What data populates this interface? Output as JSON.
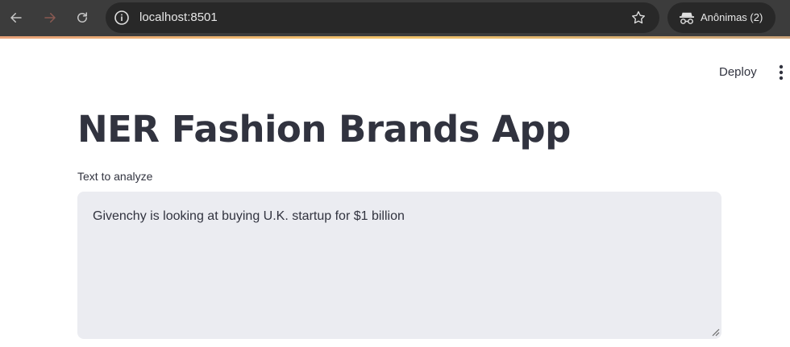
{
  "browser": {
    "url": "localhost:8501",
    "incognito_label": "Anônimas (2)",
    "icons": {
      "back": "arrow-left-icon",
      "forward": "arrow-right-icon",
      "reload": "reload-icon",
      "info": "info-icon",
      "star": "star-icon",
      "incognito": "incognito-icon"
    }
  },
  "header": {
    "deploy_label": "Deploy",
    "menu_icon": "kebab-menu-icon"
  },
  "main": {
    "title": "NER Fashion Brands App",
    "text_input": {
      "label": "Text to analyze",
      "value": "Givenchy is looking at buying U.K. startup for $1 billion"
    }
  },
  "colors": {
    "chrome_bg": "#3c3c3c",
    "url_bar_bg": "#282828",
    "text_primary": "#31333f",
    "textarea_bg": "#ebecf1"
  }
}
